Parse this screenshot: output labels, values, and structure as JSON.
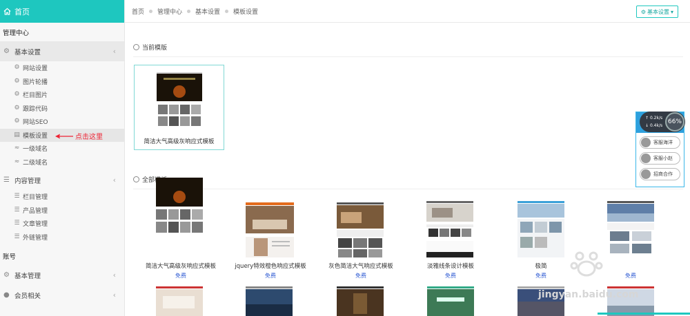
{
  "sidebar": {
    "home_label": "首页",
    "section_manage": "管理中心",
    "basic_settings": {
      "label": "基本设置",
      "items": [
        {
          "label": "网站设置",
          "icon": "gear-icon"
        },
        {
          "label": "图片轮播",
          "icon": "gear-icon"
        },
        {
          "label": "栏目图片",
          "icon": "gear-icon"
        },
        {
          "label": "跟踪代码",
          "icon": "gear-icon"
        },
        {
          "label": "网站SEO",
          "icon": "gear-icon"
        },
        {
          "label": "模板设置",
          "icon": "template-icon"
        },
        {
          "label": "一级域名",
          "icon": "wifi-icon"
        },
        {
          "label": "二级域名",
          "icon": "wifi-icon"
        }
      ]
    },
    "content_manage": {
      "label": "内容管理",
      "items": [
        {
          "label": "栏目管理"
        },
        {
          "label": "产品管理"
        },
        {
          "label": "文章管理"
        },
        {
          "label": "外链管理"
        }
      ]
    },
    "section_account": "账号",
    "account_basic": "基本管理",
    "member": "会员相关"
  },
  "annotation": "点击这里",
  "breadcrumb": [
    "首页",
    "管理中心",
    "基本设置",
    "模板设置"
  ],
  "top_button": "基本设置",
  "current_section": "当前模版",
  "current_template": "简洁大气高级灰响应式模板",
  "all_section": "全部模板",
  "templates": [
    {
      "name": "简洁大气高级灰响应式模板",
      "badge": "免费"
    },
    {
      "name": "jquery特效橙色响应式模板",
      "badge": "免费"
    },
    {
      "name": "灰色简洁大气响应式模板",
      "badge": "免费"
    },
    {
      "name": "淡雅线条设计模板",
      "badge": "免费"
    },
    {
      "name": "极简",
      "badge": "免费"
    },
    {
      "name": "",
      "badge": "免费"
    }
  ],
  "float_widget": {
    "speed_up": "0.2k/s",
    "speed_down": "0.4k/s",
    "percent": "66%",
    "buttons": [
      "客服海洋",
      "客服小赵",
      "招商合作"
    ]
  },
  "watermark": "jingyan.baidu.com",
  "colors": {
    "accent": "#1ec7bf",
    "annotation": "#e02233",
    "free": "#2f5bd3"
  }
}
